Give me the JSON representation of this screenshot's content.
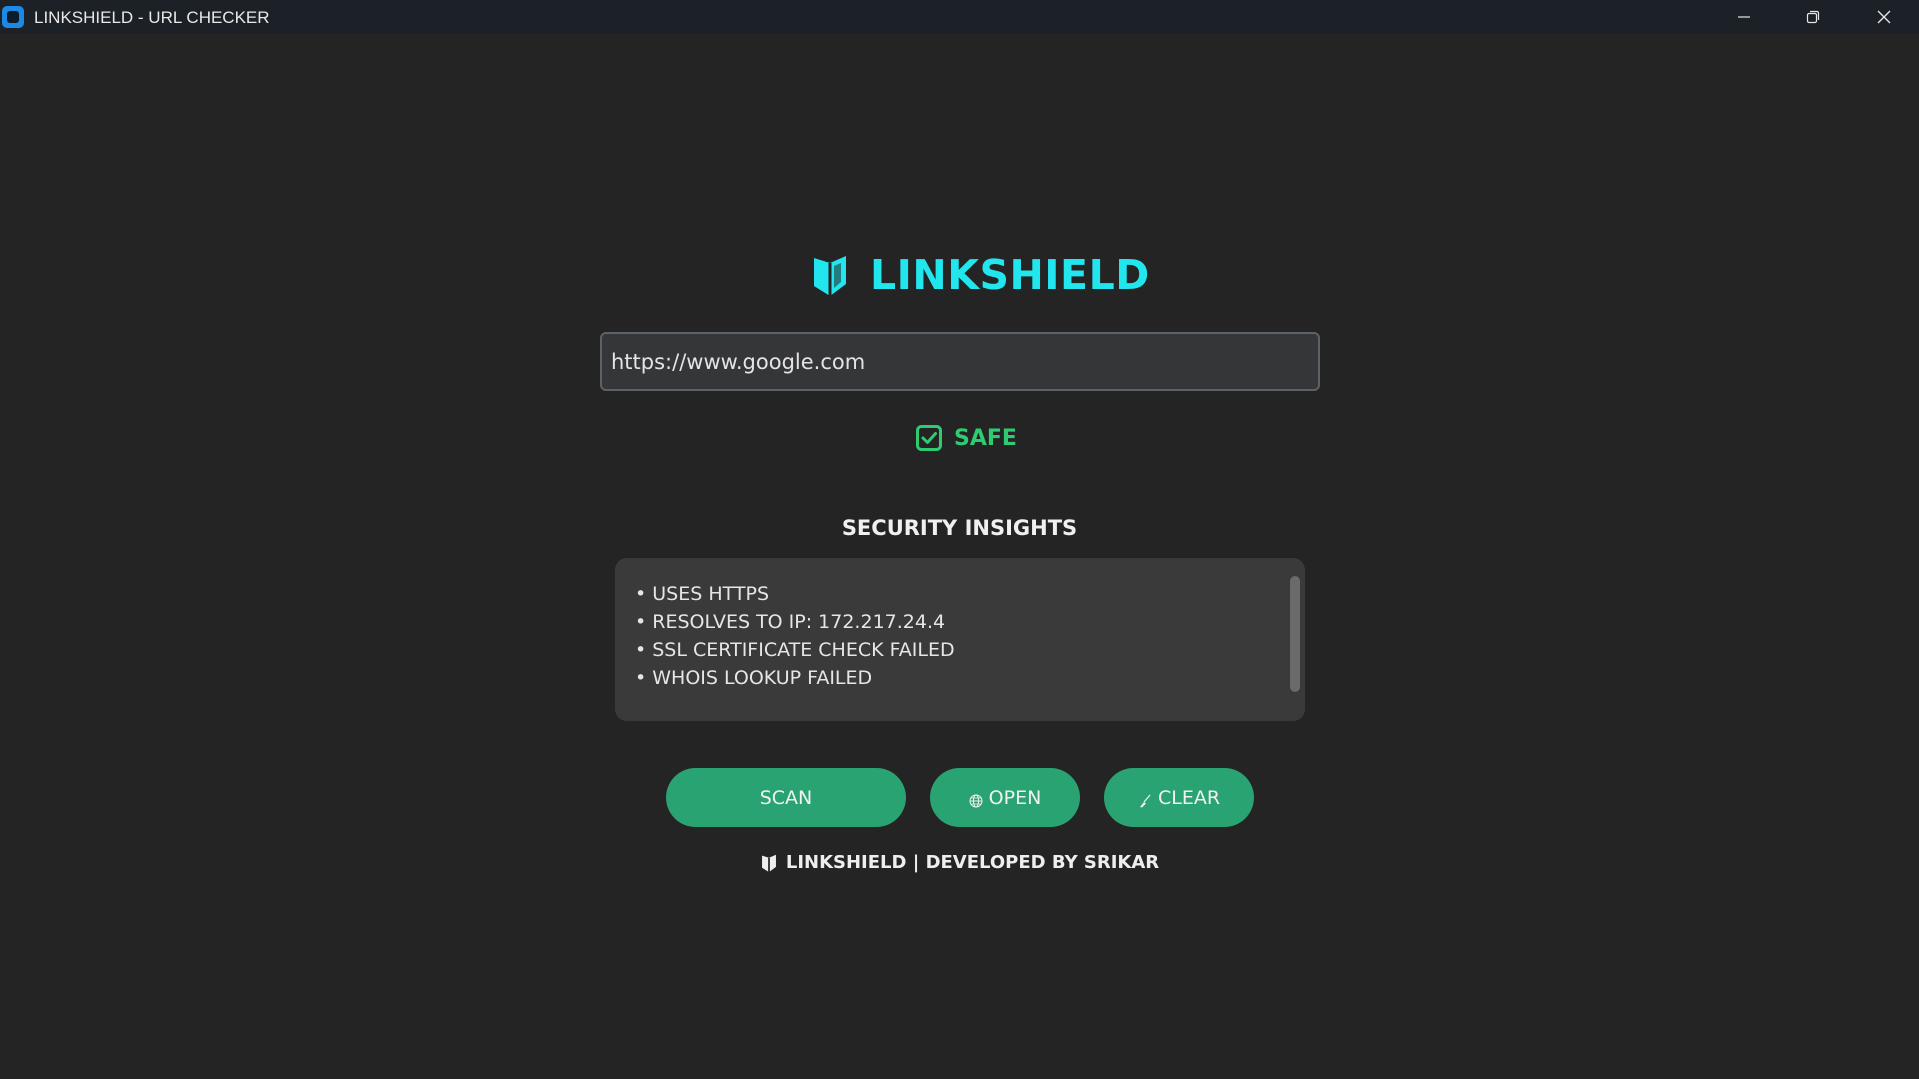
{
  "window": {
    "title": "LINKSHIELD - URL CHECKER",
    "app_icon": "app-icon",
    "controls": [
      "minimize-icon",
      "restore-icon",
      "close-icon"
    ]
  },
  "app": {
    "logo_icon": "shield-icon",
    "title": "LINKSHIELD",
    "accent_color": "#22e6ee"
  },
  "url_input": {
    "value": "https://www.google.com"
  },
  "status": {
    "icon": "checkbox-checked-icon",
    "label": "SAFE",
    "color": "#2ecc71"
  },
  "insights": {
    "heading": "SECURITY INSIGHTS",
    "items": [
      "• USES HTTPS",
      "• RESOLVES TO IP: 172.217.24.4",
      "• SSL CERTIFICATE CHECK FAILED",
      "• WHOIS LOOKUP FAILED"
    ]
  },
  "actions": {
    "scan_label": "SCAN",
    "open_label": "OPEN",
    "open_icon": "globe-icon",
    "clear_label": "CLEAR",
    "clear_icon": "broom-icon",
    "button_color": "#2aa372"
  },
  "footer": {
    "icon": "shield-icon",
    "text": "LINKSHIELD | DEVELOPED BY SRIKAR"
  }
}
